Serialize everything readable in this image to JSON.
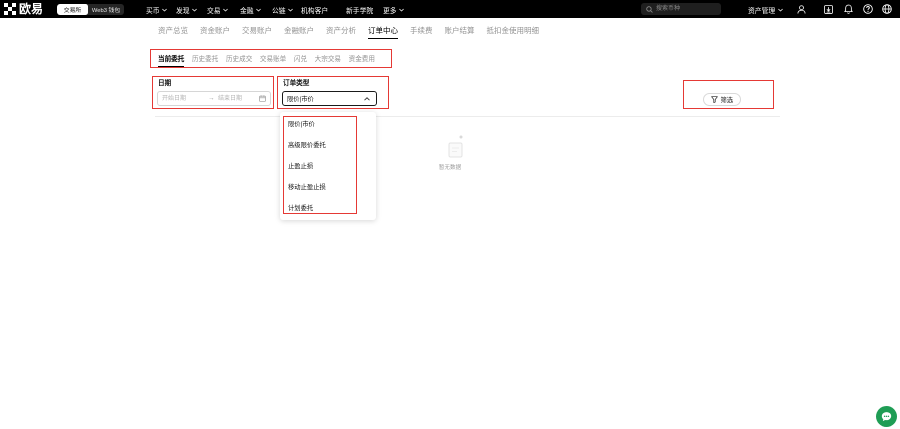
{
  "brand": {
    "name": "欧易"
  },
  "mode_switch": {
    "exchange": "交易所",
    "wallet": "Web3 钱包"
  },
  "nav": {
    "items": [
      {
        "label": "买币"
      },
      {
        "label": "发现"
      },
      {
        "label": "交易"
      },
      {
        "label": "金融"
      },
      {
        "label": "公链"
      },
      {
        "label": "机构客户"
      },
      {
        "label": "新手学院"
      },
      {
        "label": "更多"
      }
    ]
  },
  "search": {
    "placeholder": "搜索币种"
  },
  "header_right": {
    "asset_management": "资产管理",
    "icons": [
      "user-icon",
      "download-icon",
      "bell-icon",
      "help-icon",
      "globe-icon"
    ]
  },
  "asset_tabs": {
    "items": [
      {
        "label": "资产总览",
        "active": false
      },
      {
        "label": "资金账户",
        "active": false
      },
      {
        "label": "交易账户",
        "active": false
      },
      {
        "label": "金融账户",
        "active": false
      },
      {
        "label": "资产分析",
        "active": false
      },
      {
        "label": "订单中心",
        "active": true
      },
      {
        "label": "手续费",
        "active": false
      },
      {
        "label": "账户结算",
        "active": false
      },
      {
        "label": "抵扣金使用明细",
        "active": false
      }
    ]
  },
  "order_tabs": {
    "items": [
      {
        "label": "当前委托",
        "active": true
      },
      {
        "label": "历史委托",
        "active": false
      },
      {
        "label": "历史成交",
        "active": false
      },
      {
        "label": "交易账单",
        "active": false
      },
      {
        "label": "闪兑",
        "active": false
      },
      {
        "label": "大宗交易",
        "active": false
      },
      {
        "label": "资金费用",
        "active": false
      }
    ]
  },
  "filters": {
    "date": {
      "label": "日期",
      "start_placeholder": "开始日期",
      "separator": "→",
      "end_placeholder": "结束日期"
    },
    "order_type": {
      "label": "订单类型",
      "value": "限价|市价",
      "options": [
        "限价|市价",
        "高级限价委托",
        "止盈止损",
        "移动止盈止损",
        "计划委托"
      ]
    },
    "filter_button": {
      "label": "筛选"
    }
  },
  "empty_state": {
    "text": "暂无数据"
  },
  "colors": {
    "topbar_bg": "#000000",
    "active_text": "#000000",
    "inactive_text": "#929292",
    "annotation_red": "#e53935",
    "chat_button": "#1f9d55"
  }
}
